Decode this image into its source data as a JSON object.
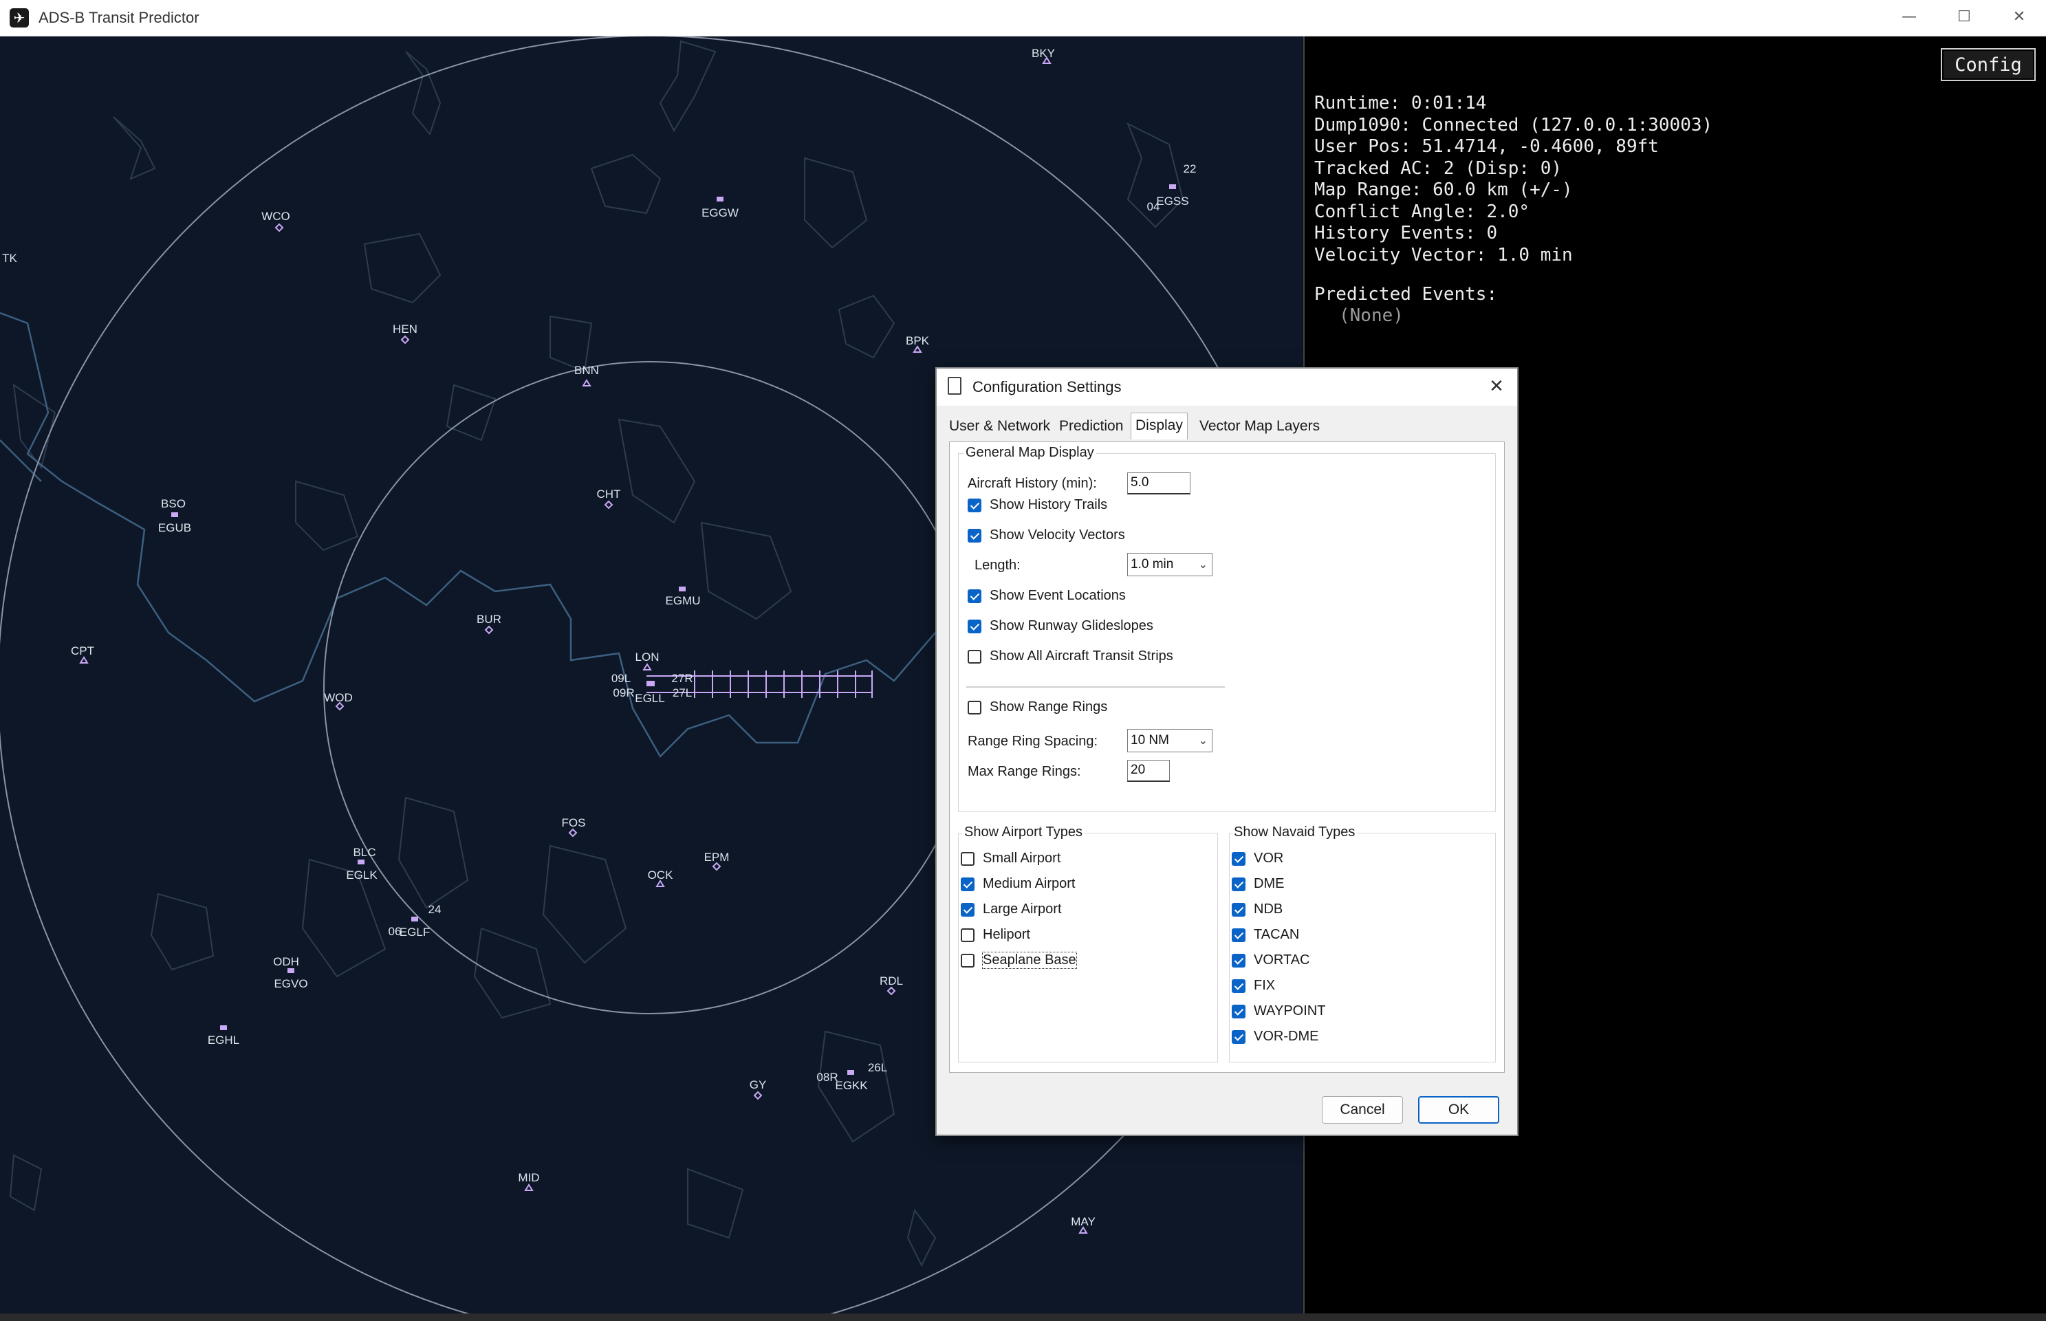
{
  "window": {
    "title": "ADS-B Transit Predictor",
    "minimize_glyph": "—",
    "maximize_glyph": "☐",
    "close_glyph": "✕"
  },
  "info_panel": {
    "config_button": "Config",
    "runtime": "Runtime: 0:01:14",
    "dump1090": "Dump1090: Connected (127.0.0.1:30003)",
    "user_pos": "User Pos: 51.4714, -0.4600, 89ft",
    "tracked": "Tracked AC: 2 (Disp: 0)",
    "map_range": "Map Range: 60.0 km (+/-)",
    "conflict_angle": "Conflict Angle: 2.0°",
    "history_events": "History Events: 0",
    "velocity_vector": "Velocity Vector: 1.0 min",
    "predicted_title": "Predicted Events:",
    "predicted_none": "(None)"
  },
  "map": {
    "colors": {
      "background": "#0d1727",
      "range_ring": "#8b93a6",
      "coastline": "#3c5f80",
      "land_outline": "#2f3b4c",
      "marker": "#c9a8f5",
      "label": "#dfe4ee"
    },
    "navaids": [
      "BKY",
      "WCO",
      "TK",
      "HEN",
      "BNN",
      "BPK",
      "BSO",
      "CHT",
      "CPT",
      "BUR",
      "LON",
      "WOD",
      "FOS",
      "BLC",
      "EPM",
      "OCK",
      "ODH",
      "RDL",
      "GY",
      "MID",
      "MAY"
    ],
    "airports": [
      "EGGW",
      "EGSS",
      "EGUB",
      "EGMU",
      "EGLL",
      "EGLK",
      "EGLF",
      "EGVO",
      "EGHL",
      "EGKK"
    ],
    "runways": [
      "09L",
      "27R",
      "09R",
      "27L",
      "04",
      "22",
      "06",
      "24",
      "08R",
      "26L"
    ]
  },
  "dialog": {
    "title": "Configuration Settings",
    "close_glyph": "✕",
    "tabs": [
      "User & Network",
      "Prediction",
      "Display",
      "Vector Map Layers"
    ],
    "active_tab": "Display",
    "general_group": "General Map Display",
    "aircraft_history_label": "Aircraft History (min):",
    "aircraft_history_value": "5.0",
    "show_history_trails": "Show History Trails",
    "show_velocity_vectors": "Show Velocity Vectors",
    "length_label": "Length:",
    "length_value": "1.0 min",
    "show_event_locations": "Show Event Locations",
    "show_runway_glideslopes": "Show Runway Glideslopes",
    "show_all_transit_strips": "Show All Aircraft Transit Strips",
    "show_range_rings": "Show Range Rings",
    "range_ring_spacing_label": "Range Ring Spacing:",
    "range_ring_spacing_value": "10 NM",
    "max_range_rings_label": "Max Range Rings:",
    "max_range_rings_value": "20",
    "airport_types_group": "Show Airport Types",
    "airport_types": [
      {
        "label": "Small Airport",
        "checked": false
      },
      {
        "label": "Medium Airport",
        "checked": true
      },
      {
        "label": "Large Airport",
        "checked": true
      },
      {
        "label": "Heliport",
        "checked": false
      },
      {
        "label": "Seaplane Base",
        "checked": false
      }
    ],
    "navaid_types_group": "Show Navaid Types",
    "navaid_types": [
      {
        "label": "VOR",
        "checked": true
      },
      {
        "label": "DME",
        "checked": true
      },
      {
        "label": "NDB",
        "checked": true
      },
      {
        "label": "TACAN",
        "checked": true
      },
      {
        "label": "VORTAC",
        "checked": true
      },
      {
        "label": "FIX",
        "checked": true
      },
      {
        "label": "WAYPOINT",
        "checked": true
      },
      {
        "label": "VOR-DME",
        "checked": true
      }
    ],
    "cancel_button": "Cancel",
    "ok_button": "OK",
    "accent_color": "#0a64c8"
  }
}
